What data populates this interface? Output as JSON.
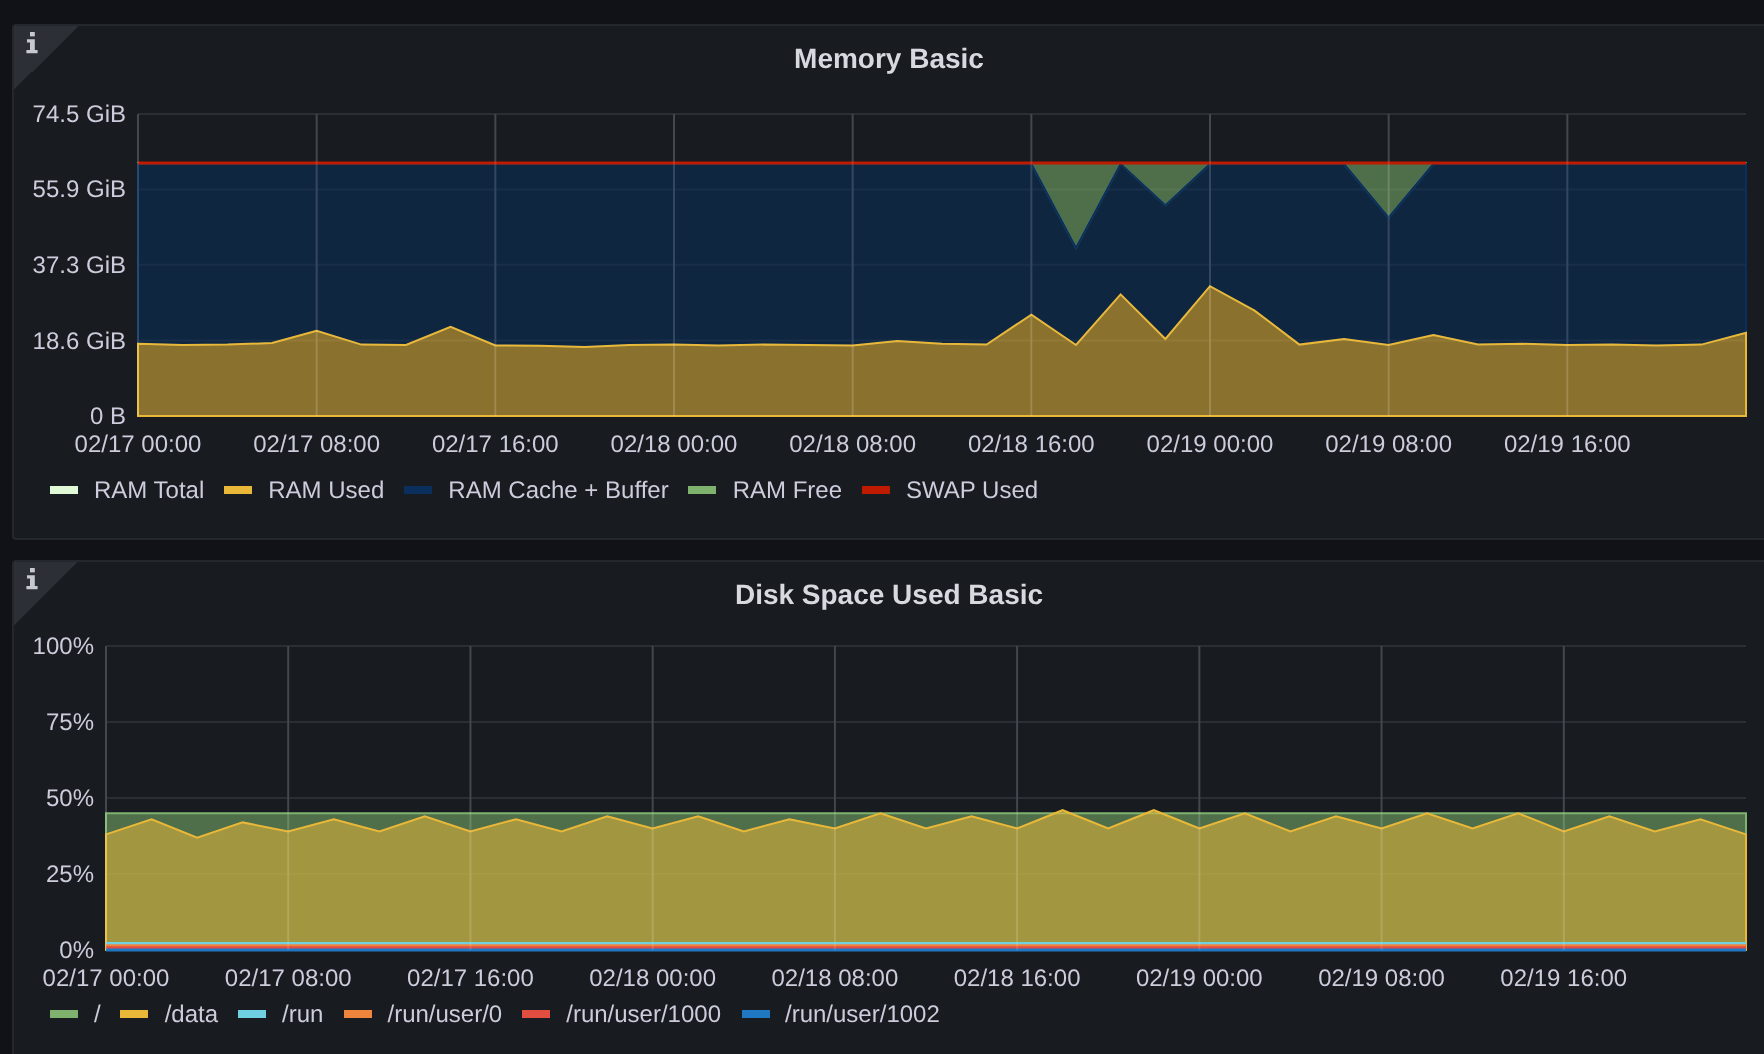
{
  "panels": [
    {
      "title": "Memory Basic",
      "chart_data": {
        "type": "area",
        "stacked": true,
        "grid": true,
        "ylim": [
          0,
          74.5
        ],
        "categories": [
          "02/17 00:00",
          null,
          null,
          null,
          "02/17 08:00",
          null,
          null,
          null,
          "02/17 16:00",
          null,
          null,
          null,
          "02/18 00:00",
          null,
          null,
          null,
          "02/18 08:00",
          null,
          null,
          null,
          "02/18 16:00",
          null,
          null,
          null,
          "02/19 00:00",
          null,
          null,
          null,
          "02/19 08:00",
          null,
          null,
          null,
          "02/19 16:00",
          null,
          null,
          null,
          null
        ],
        "yticks": [
          {
            "value": 0,
            "label": "0 B"
          },
          {
            "value": 18.6,
            "label": "18.6 GiB"
          },
          {
            "value": 37.3,
            "label": "37.3 GiB"
          },
          {
            "value": 55.9,
            "label": "55.9 GiB"
          },
          {
            "value": 74.5,
            "label": "74.5 GiB"
          }
        ],
        "series": [
          {
            "name": "RAM Total",
            "color": "#e0f9d7",
            "type": "line",
            "values": [
              null,
              null,
              null,
              null,
              null,
              null,
              null,
              null,
              null,
              null,
              null,
              null,
              null,
              null,
              null,
              null,
              null,
              null,
              null,
              null,
              null,
              null,
              null,
              null,
              null,
              null,
              null,
              null,
              null,
              null,
              null,
              null,
              null,
              null,
              null,
              null,
              null
            ]
          },
          {
            "name": "RAM Used",
            "color": "#eab839",
            "type": "area",
            "values": [
              17.8,
              17.5,
              17.6,
              18,
              21,
              17.6,
              17.5,
              22,
              17.4,
              17.3,
              17,
              17.5,
              17.6,
              17.4,
              17.6,
              17.5,
              17.4,
              18.5,
              17.8,
              17.6,
              25,
              17.5,
              30,
              19,
              32,
              26,
              17.6,
              19,
              17.5,
              20,
              17.6,
              17.8,
              17.5,
              17.6,
              17.4,
              17.6,
              20.5
            ]
          },
          {
            "name": "RAM Cache + Buffer",
            "color": "#0a2f5c",
            "type": "area",
            "values": [
              44.4,
              44.7,
              44.6,
              44.2,
              41.2,
              44.6,
              44.7,
              40.2,
              44.8,
              44.9,
              45.2,
              44.7,
              44.6,
              44.8,
              44.6,
              44.7,
              44.8,
              43.7,
              44.4,
              44.6,
              37.2,
              24,
              32.2,
              33,
              30.2,
              36.2,
              44.6,
              43.2,
              31.5,
              42.2,
              44.6,
              44.4,
              44.7,
              44.6,
              44.8,
              44.6,
              41.7
            ]
          },
          {
            "name": "RAM Free",
            "color": "#7eb26d",
            "type": "area",
            "values": [
              0.2,
              0.2,
              0.2,
              0.2,
              0.2,
              0.2,
              0.2,
              0.2,
              0.2,
              0.2,
              0.2,
              0.2,
              0.2,
              0.2,
              0.2,
              0.2,
              0.2,
              0.2,
              0.2,
              0.2,
              0.2,
              20.9,
              0.2,
              10.4,
              0.2,
              0.2,
              0.2,
              0.2,
              13.4,
              0.2,
              0.2,
              0.2,
              0.2,
              0.2,
              0.2,
              0.2,
              0.2
            ]
          },
          {
            "name": "SWAP Used",
            "color": "#bf1b00",
            "type": "line",
            "values": [
              62.4,
              62.4,
              62.4,
              62.4,
              62.4,
              62.4,
              62.4,
              62.4,
              62.4,
              62.4,
              62.4,
              62.4,
              62.4,
              62.4,
              62.4,
              62.4,
              62.4,
              62.4,
              62.4,
              62.4,
              62.4,
              62.4,
              62.4,
              62.4,
              62.4,
              62.4,
              62.4,
              62.4,
              62.4,
              62.4,
              62.4,
              62.4,
              62.4,
              62.4,
              62.4,
              62.4,
              62.4
            ]
          }
        ]
      }
    },
    {
      "title": "Disk Space Used Basic",
      "chart_data": {
        "type": "area",
        "stacked": false,
        "grid": true,
        "ylim": [
          0,
          100
        ],
        "categories": [
          "02/17 00:00",
          null,
          null,
          null,
          "02/17 08:00",
          null,
          null,
          null,
          "02/17 16:00",
          null,
          null,
          null,
          "02/18 00:00",
          null,
          null,
          null,
          "02/18 08:00",
          null,
          null,
          null,
          "02/18 16:00",
          null,
          null,
          null,
          "02/19 00:00",
          null,
          null,
          null,
          "02/19 08:00",
          null,
          null,
          null,
          "02/19 16:00",
          null,
          null,
          null,
          null
        ],
        "yticks": [
          {
            "value": 0,
            "label": "0%"
          },
          {
            "value": 25,
            "label": "25%"
          },
          {
            "value": 50,
            "label": "50%"
          },
          {
            "value": 75,
            "label": "75%"
          },
          {
            "value": 100,
            "label": "100%"
          }
        ],
        "series": [
          {
            "name": "/",
            "color": "#7eb26d",
            "type": "area",
            "values": [
              45,
              45,
              45,
              45,
              45,
              45,
              45,
              45,
              45,
              45,
              45,
              45,
              45,
              45,
              45,
              45,
              45,
              45,
              45,
              45,
              45,
              45,
              45,
              45,
              45,
              45,
              45,
              45,
              45,
              45,
              45,
              45,
              45,
              45,
              45,
              45,
              45
            ]
          },
          {
            "name": "/data",
            "color": "#eab839",
            "type": "area",
            "values": [
              38,
              43,
              37,
              42,
              39,
              43,
              39,
              44,
              39,
              43,
              39,
              44,
              40,
              44,
              39,
              43,
              40,
              45,
              40,
              44,
              40,
              46,
              40,
              46,
              40,
              45,
              39,
              44,
              40,
              45,
              40,
              45,
              39,
              44,
              39,
              43,
              38
            ]
          },
          {
            "name": "/run",
            "color": "#6ed0e0",
            "type": "line",
            "values": [
              2.1,
              2.1,
              2.1,
              2.1,
              2.1,
              2.1,
              2.1,
              2.1,
              2.1,
              2.1,
              2.1,
              2.1,
              2.1,
              2.1,
              2.1,
              2.1,
              2.1,
              2.1,
              2.1,
              2.1,
              2.1,
              2.1,
              2.1,
              2.1,
              2.1,
              2.1,
              2.1,
              2.1,
              2.1,
              2.1,
              2.1,
              2.1,
              2.1,
              2.1,
              2.1,
              2.1,
              2.1
            ]
          },
          {
            "name": "/run/user/0",
            "color": "#ef843c",
            "type": "line",
            "values": [
              1.4,
              1.4,
              1.4,
              1.4,
              1.4,
              1.4,
              1.4,
              1.4,
              1.4,
              1.4,
              1.4,
              1.4,
              1.4,
              1.4,
              1.4,
              1.4,
              1.4,
              1.4,
              1.4,
              1.4,
              1.4,
              1.4,
              1.4,
              1.4,
              1.4,
              1.4,
              1.4,
              1.4,
              1.4,
              1.4,
              1.4,
              1.4,
              1.4,
              1.4,
              1.4,
              1.4,
              1.4
            ]
          },
          {
            "name": "/run/user/1000",
            "color": "#e24d42",
            "type": "line",
            "values": [
              0.7,
              0.7,
              0.7,
              0.7,
              0.7,
              0.7,
              0.7,
              0.7,
              0.7,
              0.7,
              0.7,
              0.7,
              0.7,
              0.7,
              0.7,
              0.7,
              0.7,
              0.7,
              0.7,
              0.7,
              0.7,
              0.7,
              0.7,
              0.7,
              0.7,
              0.7,
              0.7,
              0.7,
              0.7,
              0.7,
              0.7,
              0.7,
              0.7,
              0.7,
              0.7,
              0.7,
              0.7
            ]
          },
          {
            "name": "/run/user/1002",
            "color": "#1f78c1",
            "type": "line",
            "values": [
              0,
              0,
              0,
              0,
              0,
              0,
              0,
              0,
              0,
              0,
              0,
              0,
              0,
              0,
              0,
              0,
              0,
              0,
              0,
              0,
              0,
              0,
              0,
              0,
              0,
              0,
              0,
              0,
              0,
              0,
              0,
              0,
              0,
              0,
              0,
              0,
              0
            ]
          }
        ]
      }
    }
  ]
}
